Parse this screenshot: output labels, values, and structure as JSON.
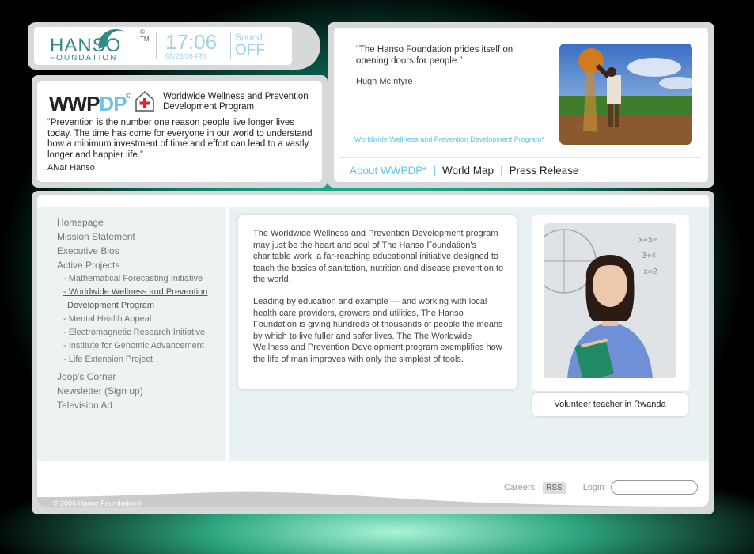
{
  "header": {
    "logo_main": "HANSO",
    "logo_sub": "FOUNDATION",
    "logo_mark": "©\nTM",
    "time": "17:06",
    "date": "08/26/06 FRI",
    "sound_label": "Sound",
    "sound_value": "OFF"
  },
  "program_panel": {
    "logo_part1": "WWP",
    "logo_part2": "DP",
    "logo_copy": "©",
    "title": "Worldwide Wellness and Prevention Development Program",
    "quote": "“Prevention is the number one reason people live longer lives today. The time has come for everyone in our world to understand how a minimum investment of time and effort can lead to a vastly longer and happier life.”",
    "author": "Alvar Hanso"
  },
  "feature_panel": {
    "quote": "“The Hanso Foundation prides itself on opening doors for people.”",
    "author": "Hugh McIntyre",
    "program_label": "Worldwide Wellness and Prevention Development Program*",
    "nav": [
      {
        "label": "About WWPDP*"
      },
      {
        "label": "World Map"
      },
      {
        "label": "Press Release"
      }
    ]
  },
  "sidebar": {
    "items": [
      {
        "label": "Homepage"
      },
      {
        "label": "Mission Statement"
      },
      {
        "label": "Executive Bios"
      },
      {
        "label": "Active Projects"
      }
    ],
    "subitems": [
      {
        "label": "- Mathematical Forecasting Initiative"
      },
      {
        "label": "- Worldwide Wellness and Prevention",
        "cont": "Development Program"
      },
      {
        "label": "- Mental Health Appeal"
      },
      {
        "label": "- Electromagnetic Research Initiative"
      },
      {
        "label": "- Institute for Genomic Advancement"
      },
      {
        "label": "- Life Extension Project"
      }
    ],
    "items_after": [
      {
        "label": "Joop's Corner"
      },
      {
        "label": "Newsletter (Sign up)"
      },
      {
        "label": "Television Ad"
      }
    ]
  },
  "main": {
    "paragraph1": "The Worldwide Wellness and Prevention Development program may just be the heart and soul of The Hanso Foundation's charitable work: a far-reaching educational initiative designed to teach the basics of sanitation, nutrition and disease prevention to the world.",
    "paragraph2": "Leading by education and example — and working with local health care providers, growers and utilities, The Hanso Foundation is giving hundreds of thousands of people the means by which to live fuller and safer lives. The The Worldwide Wellness and Prevention Development program exemplifies how the life of man improves with only the simplest of tools.",
    "photo_caption": "Volunteer teacher in Rwanda"
  },
  "footer": {
    "careers": "Careers",
    "rss": "RSS",
    "login": "Login",
    "login_value": "",
    "copyright": "© 2006 Hanso Foundation®"
  },
  "colors": {
    "accent": "#5bc8e8",
    "brand": "#2f8a88"
  }
}
